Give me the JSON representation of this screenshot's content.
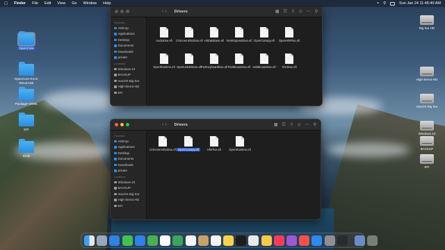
{
  "menubar": {
    "apple": "",
    "app": "Finder",
    "items": [
      "File",
      "Edit",
      "View",
      "Go",
      "Window",
      "Help"
    ],
    "clock": "Sun Jan 24  11:46:40 AM"
  },
  "desktop_left": [
    {
      "label": "OpenCore"
    },
    {
      "label": "OpenCore-0.6.6-RELEASE"
    },
    {
      "label": "Package-VSMC"
    },
    {
      "label": "EFI"
    },
    {
      "label": "Desk"
    }
  ],
  "desktop_right": [
    {
      "label": "Big Sur HD"
    },
    {
      "label": "High-Sierra-HD"
    },
    {
      "label": "macOS Big Sur"
    },
    {
      "label": "Windows-10"
    },
    {
      "label": "BACKUP"
    },
    {
      "label": "EFI"
    }
  ],
  "window_top": {
    "title": "Drivers",
    "sidebar": {
      "favorites_heading": "Favorites",
      "favorites": [
        "AirDrop",
        "Applications",
        "Desktop",
        "Documents",
        "Downloads",
        "private"
      ],
      "locations_heading": "Locations",
      "locations": [
        "Windows-10",
        "BACKUP",
        "macOS Big Sur",
        "High-Sierra-HD",
        "EFI"
      ]
    },
    "files": [
      "AudioDxe.efi",
      "CrScreenshotDxe.efi",
      "HiiDatabase.efi",
      "NvmExpressDxe.efi",
      "OpenCanopy.efi",
      "OpenHfsPlus.efi",
      "OpenRuntime.efi",
      "OpenUsbKbDxe.efi",
      "Ps2KeyboardDxe.efi",
      "Ps2MouseDxe.efi",
      "UsbMouseDxe.efi",
      "XhciDxe.efi"
    ]
  },
  "window_bottom": {
    "title": "Drivers",
    "sidebar": {
      "favorites_heading": "Favorites",
      "favorites": [
        "AirDrop",
        "Applications",
        "Desktop",
        "Documents",
        "Downloads",
        "private"
      ],
      "locations_heading": "Locations",
      "locations": [
        "Windows-10",
        "BACKUP",
        "macOS Big Sur",
        "High-Sierra-HD",
        "EFI"
      ]
    },
    "files": [
      "CrScreenshotDxe.efi",
      "OpenCanopy.efi",
      "HfsPlus.efi",
      "OpenRuntime.efi"
    ]
  },
  "dock": {
    "trash_icon": "trash-icon"
  },
  "colors": {
    "selection": "#2f62d0",
    "folder": "#2a8ee0",
    "window_bg": "#1e1e1f"
  }
}
